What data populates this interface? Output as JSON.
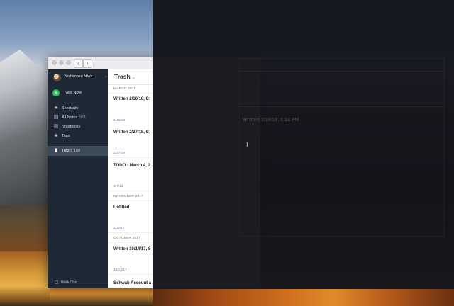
{
  "account": {
    "name": "Yoshimasa Niwa"
  },
  "sidebar": {
    "new_note": "New Note",
    "items": [
      {
        "label": "Shortcuts",
        "icon": "star-icon"
      },
      {
        "label": "All Notes",
        "count": "961",
        "icon": "note-icon"
      },
      {
        "label": "Notebooks",
        "icon": "notebook-icon"
      },
      {
        "label": "Tags",
        "icon": "tag-icon"
      }
    ],
    "trash": {
      "label": "Trash",
      "count": "199"
    },
    "work_chat": "Work Chat"
  },
  "list": {
    "title": "Trash",
    "sections": {
      "march_2018": "MARCH 2018",
      "november_2017": "NOVEMBER 2017",
      "october_2017": "OCTOBER 2017"
    },
    "notes": [
      {
        "title": "Written 2/16/18, 8:",
        "date": "2/16/18"
      },
      {
        "title": "Written 2/27/18, 9:",
        "date": "2/27/18"
      },
      {
        "title": "TODO - March 4, 2",
        "date": "3/7/18"
      },
      {
        "title": "Untitled",
        "date": "11/2/17"
      },
      {
        "title": "Written 10/14/17, 8",
        "date": "10/14/17"
      },
      {
        "title": "Schwab Account a",
        "date": ""
      }
    ]
  },
  "editor_overlay": {
    "note_title": "Written 2/16/18, 8:18 PM"
  },
  "colors": {
    "sidebar_bg": "#1f2936",
    "accent_green": "#2dbe60",
    "overlay": "#13141a"
  }
}
